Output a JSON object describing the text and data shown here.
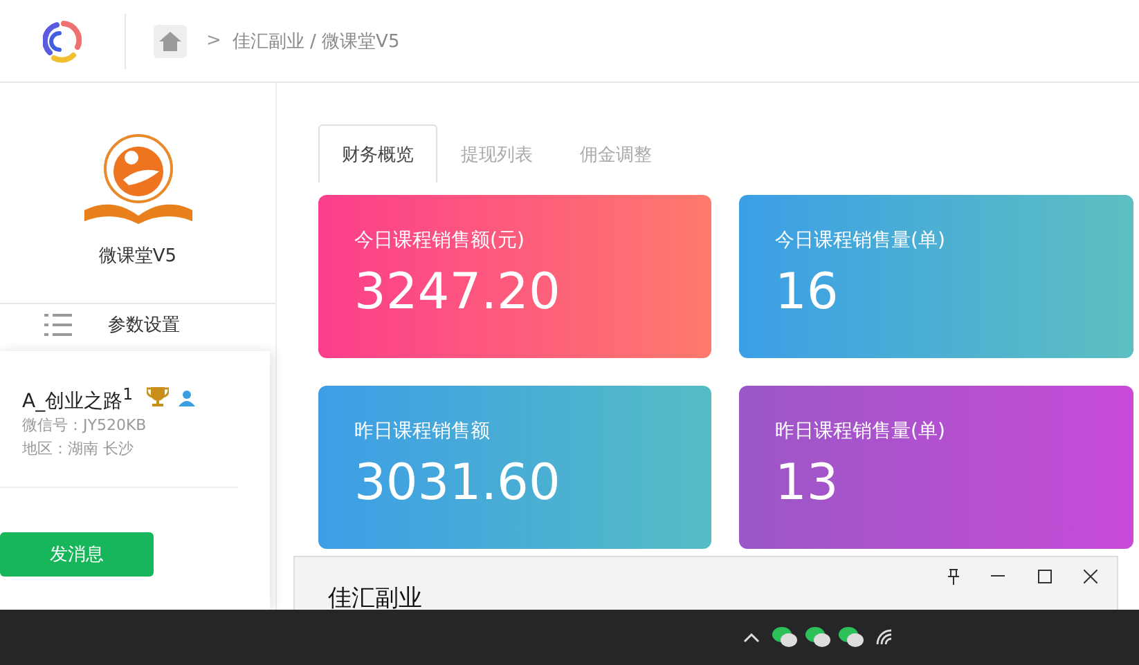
{
  "breadcrumb": {
    "separator": ">",
    "path": "佳汇副业 / 微课堂V5"
  },
  "sidebar": {
    "app_name": "微课堂V5",
    "menu_item": "参数设置"
  },
  "tabs": [
    {
      "label": "财务概览",
      "selected": true
    },
    {
      "label": "提现列表",
      "selected": false
    },
    {
      "label": "佣金调整",
      "selected": false
    }
  ],
  "stats": [
    {
      "label": "今日课程销售额(元)",
      "value": "3247.20",
      "color": "#fc3e8c"
    },
    {
      "label": "今日课程销售量(单)",
      "value": "16",
      "color": "#3b9fe6"
    },
    {
      "label": "昨日课程销售额",
      "value": "3031.60",
      "color": "#3d9ee6"
    },
    {
      "label": "昨日课程销售量(单)",
      "value": "13",
      "color": "#9a57c6"
    }
  ],
  "profile_card": {
    "name": "A_创业之路$^{1}$",
    "wechat_id": "微信号：JY520KB",
    "region": "地区：湖南 长沙",
    "button": "发消息"
  },
  "notification": {
    "title": "佳汇副业"
  }
}
